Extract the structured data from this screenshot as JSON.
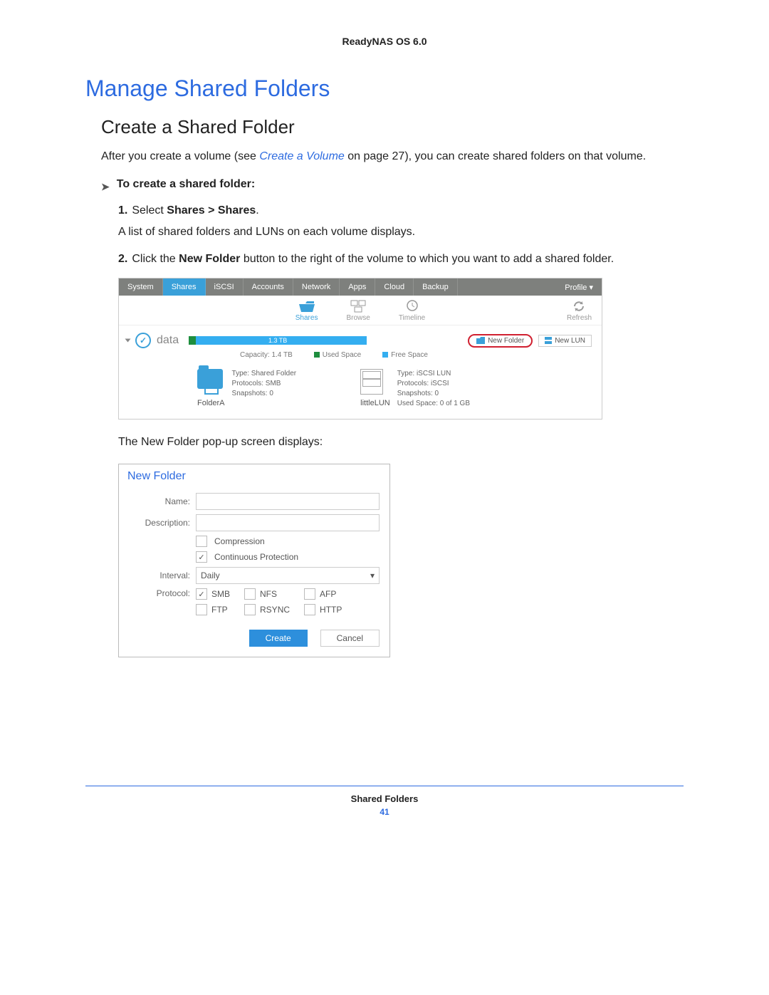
{
  "doc": {
    "header": "ReadyNAS OS 6.0",
    "h1": "Manage Shared Folders",
    "h2": "Create a Shared Folder",
    "intro_a": "After you create a volume (see ",
    "intro_link": "Create a Volume",
    "intro_b": " on page 27), you can create shared folders on that volume.",
    "lead": "To create a shared folder:",
    "step1_a": "Select ",
    "step1_b": "Shares > Shares",
    "step1_c": ".",
    "step1_sub": "A list of shared folders and LUNs on each volume displays.",
    "step2_a": "Click the ",
    "step2_b": "New Folder",
    "step2_c": " button to the right of the volume to which you want to add a shared folder.",
    "caption2": "The New Folder pop-up screen displays:",
    "footer_title": "Shared Folders",
    "page_number": "41"
  },
  "ui1": {
    "tabs": [
      "System",
      "Shares",
      "iSCSI",
      "Accounts",
      "Network",
      "Apps",
      "Cloud",
      "Backup"
    ],
    "profile": "Profile ▾",
    "toolbar": {
      "shares": "Shares",
      "browse": "Browse",
      "timeline": "Timeline",
      "refresh": "Refresh"
    },
    "volume": {
      "name": "data",
      "bar_label": "1.3 TB",
      "capacity": "Capacity: 1.4 TB",
      "legend_used": "Used Space",
      "legend_free": "Free Space",
      "new_folder_btn": "New Folder",
      "new_lun_btn": "New LUN"
    },
    "itemA": {
      "name": "FolderA",
      "l1": "Type: Shared Folder",
      "l2": "Protocols: SMB",
      "l3": "Snapshots: 0"
    },
    "itemB": {
      "name": "littleLUN",
      "l1": "Type: iSCSI LUN",
      "l2": "Protocols: iSCSI",
      "l3": "Snapshots: 0",
      "l4": "Used Space: 0 of 1 GB"
    }
  },
  "ui2": {
    "title": "New Folder",
    "labels": {
      "name": "Name:",
      "desc": "Description:",
      "interval": "Interval:",
      "protocol": "Protocol:"
    },
    "options": {
      "compression": "Compression",
      "protection": "Continuous Protection"
    },
    "interval_value": "Daily",
    "protocols": [
      "SMB",
      "NFS",
      "AFP",
      "FTP",
      "RSYNC",
      "HTTP"
    ],
    "protocol_checked": "SMB",
    "buttons": {
      "create": "Create",
      "cancel": "Cancel"
    }
  }
}
